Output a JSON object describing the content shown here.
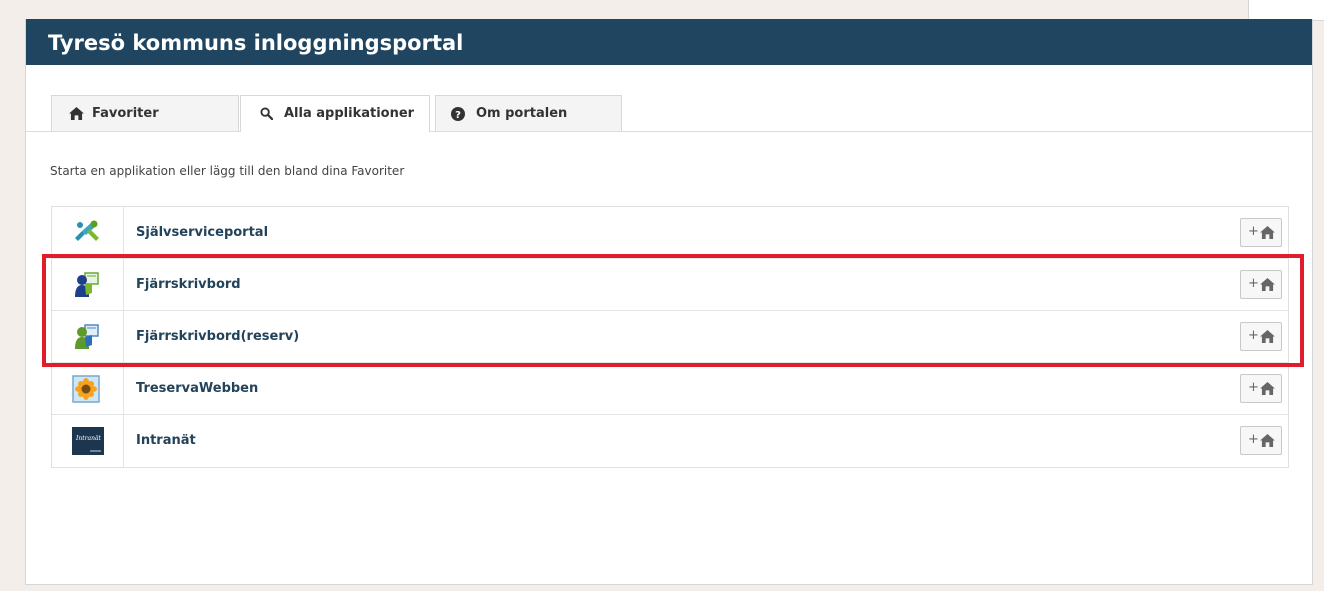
{
  "header": {
    "title": "Tyresö kommuns inloggningsportal"
  },
  "tabs": [
    {
      "label": "Favoriter",
      "icon": "home-icon",
      "active": false
    },
    {
      "label": "Alla applikationer",
      "icon": "search-icon",
      "active": true
    },
    {
      "label": "Om portalen",
      "icon": "question-icon",
      "active": false
    }
  ],
  "intro": "Starta en applikation eller lägg till den bland dina Favoriter",
  "apps": [
    {
      "name": "Självserviceportal",
      "icon": "tools-icon"
    },
    {
      "name": "Fjärrskrivbord",
      "icon": "remote-desktop-icon"
    },
    {
      "name": "Fjärrskrivbord(reserv)",
      "icon": "remote-desktop-icon"
    },
    {
      "name": "TreservaWebben",
      "icon": "sunflower-icon"
    },
    {
      "name": "Intranät",
      "icon": "intranet-logo-icon",
      "logo_text": "Intranät"
    }
  ],
  "add_favorite": {
    "plus": "+",
    "icon": "home-icon"
  },
  "colors": {
    "header_bg": "#1f4560",
    "app_name": "#22435a",
    "highlight": "#e01e2b",
    "page_bg": "#f3eeea"
  }
}
